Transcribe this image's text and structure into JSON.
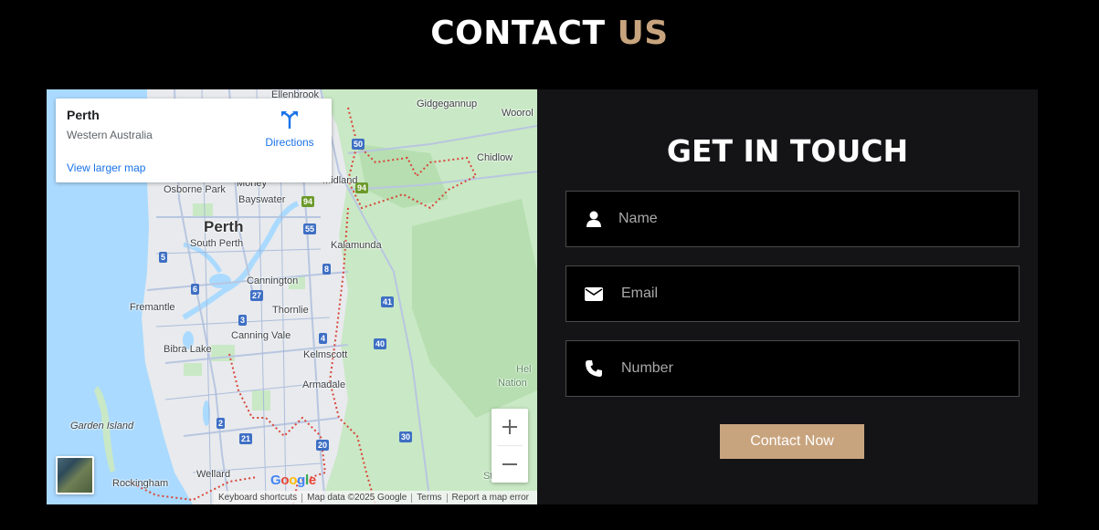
{
  "heading": {
    "part1": "CONTACT",
    "part2": "US"
  },
  "map": {
    "place_name": "Perth",
    "place_region": "Western Australia",
    "directions_label": "Directions",
    "larger_map_label": "View larger map",
    "zoom_in": "+",
    "zoom_out": "−",
    "google_logo": [
      "G",
      "o",
      "o",
      "g",
      "l",
      "e"
    ],
    "attribution": {
      "shortcuts": "Keyboard shortcuts",
      "data": "Map data ©2025 Google",
      "terms": "Terms",
      "report": "Report a map error"
    },
    "labels": {
      "ellenbrook": "Ellenbrook",
      "gidgegannup": "Gidgegannup",
      "woorol": "Woorol",
      "chidlow": "Chidlow",
      "morley": "Morley",
      "midland": "Midland",
      "osborne_park": "Osborne Park",
      "bayswater": "Bayswater",
      "perth": "Perth",
      "south_perth": "South Perth",
      "kalamunda": "Kalamunda",
      "cannington": "Cannington",
      "fremantle": "Fremantle",
      "thornlie": "Thornlie",
      "canning_vale": "Canning Vale",
      "bibra_lake": "Bibra Lake",
      "kelmscott": "Kelmscott",
      "armadale": "Armadale",
      "garden_island": "Garden Island",
      "wellard": "Wellard",
      "rockingham": "Rockingham",
      "hel": "Hel",
      "nation": "Nation",
      "sta": "Sta"
    },
    "shields": {
      "r50": "50",
      "r94a": "94",
      "r94b": "94",
      "r55": "55",
      "r5": "5",
      "r8": "8",
      "r6": "6",
      "r27": "27",
      "r41": "41",
      "r3": "3",
      "r4": "4",
      "r40": "40",
      "r2": "2",
      "r21": "21",
      "r30": "30",
      "r20": "20"
    }
  },
  "form": {
    "title": "GET IN TOUCH",
    "name_placeholder": "Name",
    "email_placeholder": "Email",
    "number_placeholder": "Number",
    "submit_label": "Contact Now"
  },
  "colors": {
    "accent": "#c8a47e",
    "background": "#000000",
    "panel": "#141417",
    "link": "#1a73e8"
  }
}
